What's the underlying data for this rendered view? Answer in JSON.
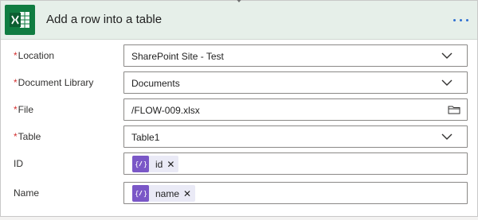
{
  "header": {
    "title": "Add a row into a table",
    "logo_icon": "excel-icon",
    "more_icon": "more-options-icon"
  },
  "fields": [
    {
      "label": "Location",
      "required": true,
      "value": "SharePoint Site - Test",
      "control": "dropdown"
    },
    {
      "label": "Document Library",
      "required": true,
      "value": "Documents",
      "control": "dropdown"
    },
    {
      "label": "File",
      "required": true,
      "value": "/FLOW-009.xlsx",
      "control": "file-picker"
    },
    {
      "label": "Table",
      "required": true,
      "value": "Table1",
      "control": "dropdown"
    },
    {
      "label": "ID",
      "required": false,
      "token": "id",
      "token_icon": "expression-icon",
      "control": "token-input"
    },
    {
      "label": "Name",
      "required": false,
      "token": "name",
      "token_icon": "expression-icon",
      "control": "token-input"
    }
  ],
  "required_marker": "*",
  "token_remove_glyph": "✕",
  "colors": {
    "header_bg": "#e6efe9",
    "excel_green": "#107c41",
    "required": "#d32f2f",
    "token_icon": "#7a57c7",
    "token_bg": "#eaeaf6",
    "more_dots": "#2f6fd1"
  }
}
